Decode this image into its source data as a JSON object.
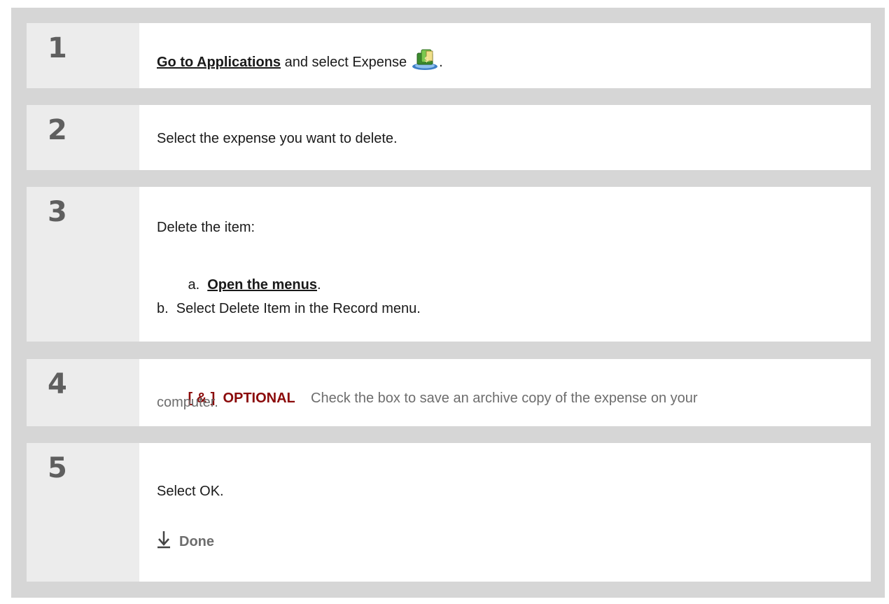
{
  "steps": [
    {
      "number": "1",
      "link": "Go to Applications",
      "text_after": " and select Expense",
      "icon": "expense-app-icon",
      "trailing": "."
    },
    {
      "number": "2",
      "text": "Select the expense you want to delete."
    },
    {
      "number": "3",
      "intro": "Delete the item:",
      "sub_a_prefix": "a.  ",
      "sub_a_link": "Open the menus",
      "sub_a_suffix": ".",
      "sub_b": "b.  Select Delete Item in the Record menu."
    },
    {
      "number": "4",
      "tag": "[ & ]  OPTIONAL",
      "text_line1": "Check the box to save an archive copy of the expense on your",
      "text_line2": "computer."
    },
    {
      "number": "5",
      "text": "Select OK.",
      "done_label": "Done",
      "done_icon": "down-arrow-icon"
    }
  ],
  "colors": {
    "frame": "#d6d6d6",
    "number_cell": "#ececec",
    "number_text": "#5f5f5f",
    "optional_tag": "#8b0a0a",
    "muted_text": "#6d6d6d"
  }
}
